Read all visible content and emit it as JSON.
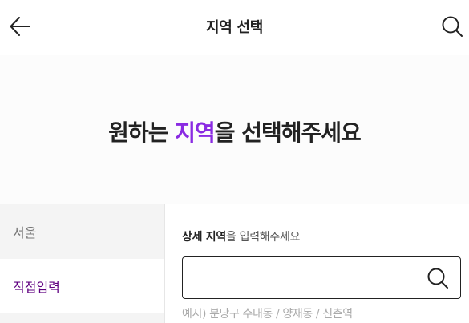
{
  "header": {
    "title": "지역 선택",
    "back_icon": "arrow-left-icon",
    "search_icon": "search-icon"
  },
  "hero": {
    "title_prefix": "원하는 ",
    "title_accent": "지역",
    "title_suffix": "을 선택해주세요",
    "accent_color": "#8a2be2"
  },
  "sidebar": {
    "items": [
      {
        "label": "서울",
        "selected": false
      },
      {
        "label": "직접입력",
        "selected": true
      }
    ]
  },
  "detail": {
    "label_bold": "상세 지역",
    "label_rest": "을 입력해주세요",
    "input_value": "",
    "input_placeholder": "",
    "search_icon": "search-icon",
    "example": "예시) 분당구 수내동 / 양재동 / 신촌역"
  },
  "colors": {
    "accent": "#8a2be2",
    "selected_text": "#5f0080",
    "sidebar_bg": "#f4f4f4"
  }
}
